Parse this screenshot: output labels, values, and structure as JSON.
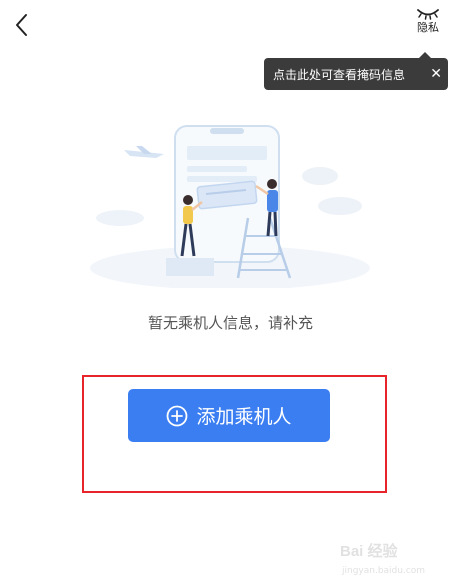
{
  "header": {
    "back_icon": "chevron-left-icon",
    "privacy_icon": "closed-eye-icon",
    "privacy_label": "隐私"
  },
  "tooltip": {
    "text": "点击此处可查看掩码信息",
    "close_icon": "close-icon",
    "close_glyph": "✕"
  },
  "empty_state": {
    "illustration": "empty-passenger-illustration",
    "message": "暂无乘机人信息，请补充"
  },
  "add_button": {
    "icon": "plus-circle-icon",
    "label": "添加乘机人",
    "color": "#3a7ef2"
  },
  "annotation": {
    "color": "#e8242a"
  },
  "watermark": {
    "logo_text": "Bai 经验",
    "sub_text": "jingyan.baidu.com"
  }
}
